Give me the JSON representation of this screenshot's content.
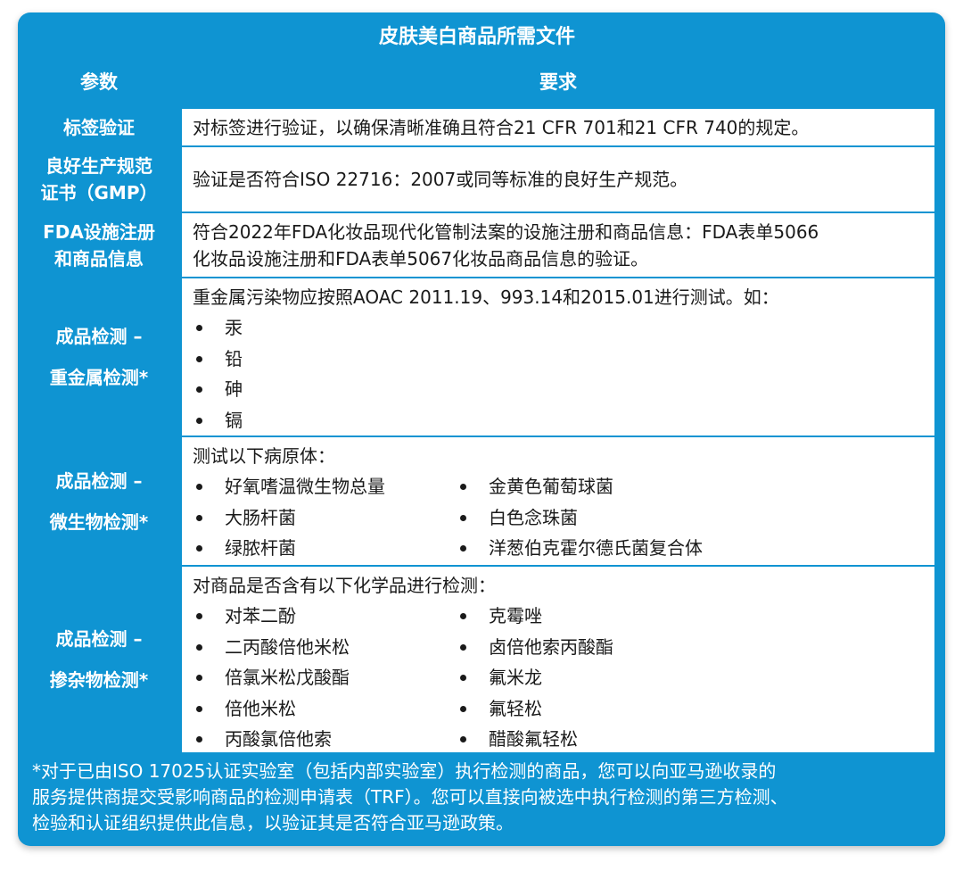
{
  "title": "皮肤美白商品所需文件",
  "header": {
    "param": "参数",
    "requirement": "要求"
  },
  "rows": [
    {
      "param": [
        "标签验证"
      ],
      "text": "对标签进行验证，以确保清晰准确且符合21 CFR 701和21 CFR 740的规定。"
    },
    {
      "param": [
        "良好生产规范",
        "证书（GMP）"
      ],
      "text": "验证是否符合ISO 22716：2007或同等标准的良好生产规范。"
    },
    {
      "param": [
        "FDA设施注册",
        "和商品信息"
      ],
      "lines": [
        "符合2022年FDA化妆品现代化管制法案的设施注册和商品信息：FDA表单5066",
        "化妆品设施注册和FDA表单5067化妆品商品信息的验证。"
      ]
    },
    {
      "param": [
        "成品检测 –",
        "重金属检测*"
      ],
      "intro": "重金属污染物应按照AOAC 2011.19、993.14和2015.01进行测试。如：",
      "items": [
        "汞",
        "铅",
        "砷",
        "镉"
      ]
    },
    {
      "param": [
        "成品检测 –",
        "微生物检测*"
      ],
      "intro": "测试以下病原体：",
      "col1": [
        "好氧嗜温微生物总量",
        "大肠杆菌",
        "绿脓杆菌"
      ],
      "col2": [
        "金黄色葡萄球菌",
        "白色念珠菌",
        "洋葱伯克霍尔德氏菌复合体"
      ]
    },
    {
      "param": [
        "成品检测 –",
        "掺杂物检测*"
      ],
      "intro": "对商品是否含有以下化学品进行检测：",
      "col1": [
        "对苯二酚",
        "二丙酸倍他米松",
        "倍氯米松戊酸酯",
        "倍他米松",
        "丙酸氯倍他索"
      ],
      "col2": [
        "克霉唑",
        "卤倍他索丙酸酯",
        "氟米龙",
        "氟轻松",
        "醋酸氟轻松"
      ]
    }
  ],
  "footnote": [
    "*对于已由ISO 17025认证实验室（包括内部实验室）执行检测的商品，您可以向亚马逊收录的",
    "服务提供商提交受影响商品的检测申请表（TRF）。您可以直接向被选中执行检测的第三方检测、",
    "检验和认证组织提供此信息，以验证其是否符合亚马逊政策。"
  ],
  "colors": {
    "accent": "#0f94d2",
    "cell_bg": "#ffffff",
    "text": "#1a1a1a"
  }
}
